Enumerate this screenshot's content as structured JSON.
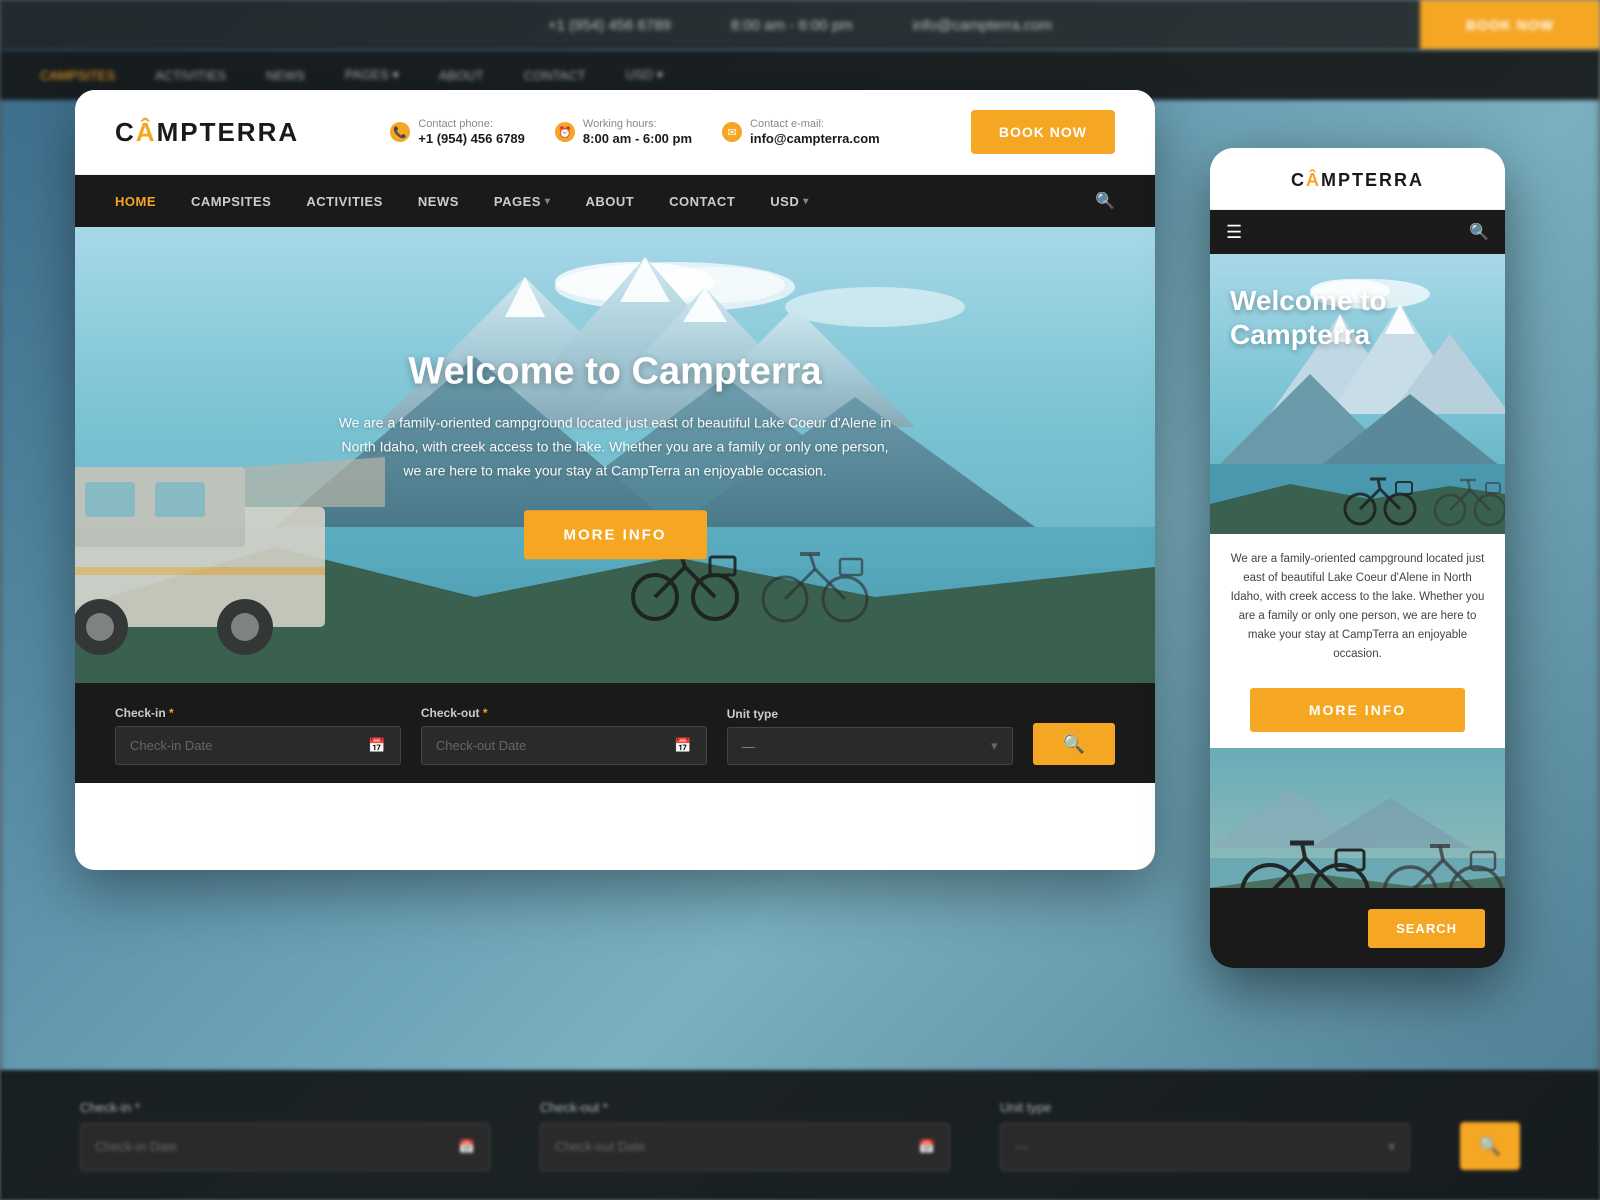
{
  "brand": {
    "name_prefix": "C",
    "name_a": "Â",
    "name_suffix": "MPTERRA",
    "logo_text": "CAMPTERRA"
  },
  "top_bar": {
    "phone_label": "Contact phone:",
    "phone_value": "+1 (954) 456 6789",
    "hours_label": "Working hours:",
    "hours_value": "8:00 am - 6:00 pm",
    "email_label": "Contact e-mail:",
    "email_value": "info@campterra.com"
  },
  "book_button": "BOOK NOW",
  "nav": {
    "items": [
      {
        "label": "HOME",
        "active": true
      },
      {
        "label": "CAMPSITES",
        "active": false
      },
      {
        "label": "ACTIVITIES",
        "active": false
      },
      {
        "label": "NEWS",
        "active": false
      },
      {
        "label": "PAGES",
        "active": false,
        "has_arrow": true
      },
      {
        "label": "ABOUT",
        "active": false
      },
      {
        "label": "CONTACT",
        "active": false
      },
      {
        "label": "USD",
        "active": false,
        "has_arrow": true
      }
    ]
  },
  "hero": {
    "title": "Welcome to Campterra",
    "description": "We are a family-oriented campground located just east of beautiful Lake Coeur d'Alene in North Idaho, with creek access to the lake. Whether you are a family or only one person, we are here to make your stay at CampTerra an enjoyable occasion.",
    "cta_label": "MORE INFO"
  },
  "booking": {
    "checkin_label": "Check-in",
    "checkin_placeholder": "Check-in Date",
    "checkout_label": "Check-out",
    "checkout_placeholder": "Check-out Date",
    "unit_label": "Unit type",
    "unit_placeholder": "—",
    "required_marker": "*"
  },
  "mobile": {
    "hero_title": "Welcome to Campterra",
    "hero_description": "We are a family-oriented campground located just east of beautiful Lake Coeur d'Alene in North Idaho, with creek access to the lake. Whether you are a family or only one person, we are here to make your stay at CampTerra an enjoyable occasion.",
    "more_info_label": "MORE INFO",
    "search_label": "SEARCH"
  },
  "colors": {
    "accent": "#f5a623",
    "dark_bg": "#1a1a1a",
    "dark_input": "#2a2a2a",
    "light_text": "#ffffff",
    "muted_text": "#888888"
  }
}
